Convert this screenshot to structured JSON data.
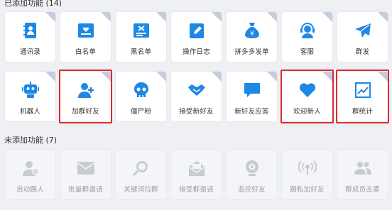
{
  "added": {
    "title": "已添加功能 (14)",
    "items": [
      {
        "label": "通讯录",
        "icon": "contacts-book-icon"
      },
      {
        "label": "白名单",
        "icon": "whitelist-card-icon"
      },
      {
        "label": "黑名单",
        "icon": "blacklist-card-icon"
      },
      {
        "label": "操作日志",
        "icon": "operation-log-pen-icon"
      },
      {
        "label": "拼多多发单",
        "icon": "money-bag-icon"
      },
      {
        "label": "客服",
        "icon": "customer-service-headset-icon"
      },
      {
        "label": "群发",
        "icon": "paper-plane-icon"
      },
      {
        "label": "机器人",
        "icon": "robot-icon"
      },
      {
        "label": "加群好友",
        "icon": "add-friend-icon"
      },
      {
        "label": "僵尸粉",
        "icon": "skull-icon"
      },
      {
        "label": "接受新好友",
        "icon": "handshake-icon"
      },
      {
        "label": "新好友应答",
        "icon": "chat-bubble-icon"
      },
      {
        "label": "欢迎新人",
        "icon": "heart-icon"
      },
      {
        "label": "群统计",
        "icon": "chart-icon"
      }
    ]
  },
  "not_added": {
    "title": "未添加功能 (7)",
    "items": [
      {
        "label": "自动踢人",
        "icon": "kick-user-icon"
      },
      {
        "label": "批量群邀请",
        "icon": "envelope-icon"
      },
      {
        "label": "关键词拉群",
        "icon": "magnifier-icon"
      },
      {
        "label": "接受群邀请",
        "icon": "open-envelope-icon"
      },
      {
        "label": "监控好友",
        "icon": "webcam-icon"
      },
      {
        "label": "踢私加好友",
        "icon": "broadcast-icon"
      },
      {
        "label": "群成员去重",
        "icon": "members-dedupe-icon"
      }
    ]
  },
  "colors": {
    "accent": "#1e88e5",
    "highlight": "#d92c2c",
    "disabled": "#c9cbd3"
  }
}
